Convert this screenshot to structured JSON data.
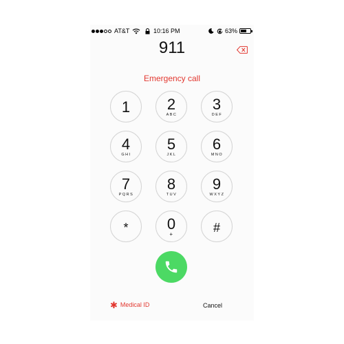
{
  "status_bar": {
    "signal_bars_filled": 3,
    "signal_bars_total": 5,
    "carrier": "AT&T",
    "time": "10:16 PM",
    "battery": "63%",
    "battery_level": 0.63,
    "icons": [
      "wifi-icon",
      "lock-icon",
      "moon-icon",
      "rotation-lock-icon",
      "battery-icon"
    ]
  },
  "dialer": {
    "number": "911",
    "label": "Emergency call",
    "backspace_icon": "backspace-icon"
  },
  "keypad": [
    {
      "digit": "1",
      "letters": ""
    },
    {
      "digit": "2",
      "letters": "ABC"
    },
    {
      "digit": "3",
      "letters": "DEF"
    },
    {
      "digit": "4",
      "letters": "GHI"
    },
    {
      "digit": "5",
      "letters": "JKL"
    },
    {
      "digit": "6",
      "letters": "MNO"
    },
    {
      "digit": "7",
      "letters": "PQRS"
    },
    {
      "digit": "8",
      "letters": "TUV"
    },
    {
      "digit": "9",
      "letters": "WXYZ"
    },
    {
      "digit": "*",
      "letters": ""
    },
    {
      "digit": "0",
      "letters": "+"
    },
    {
      "digit": "#",
      "letters": ""
    }
  ],
  "actions": {
    "call_icon": "phone-icon",
    "medical_id": "Medical ID",
    "cancel": "Cancel"
  },
  "colors": {
    "accent_red": "#e2372f",
    "call_green": "#4cd964"
  }
}
